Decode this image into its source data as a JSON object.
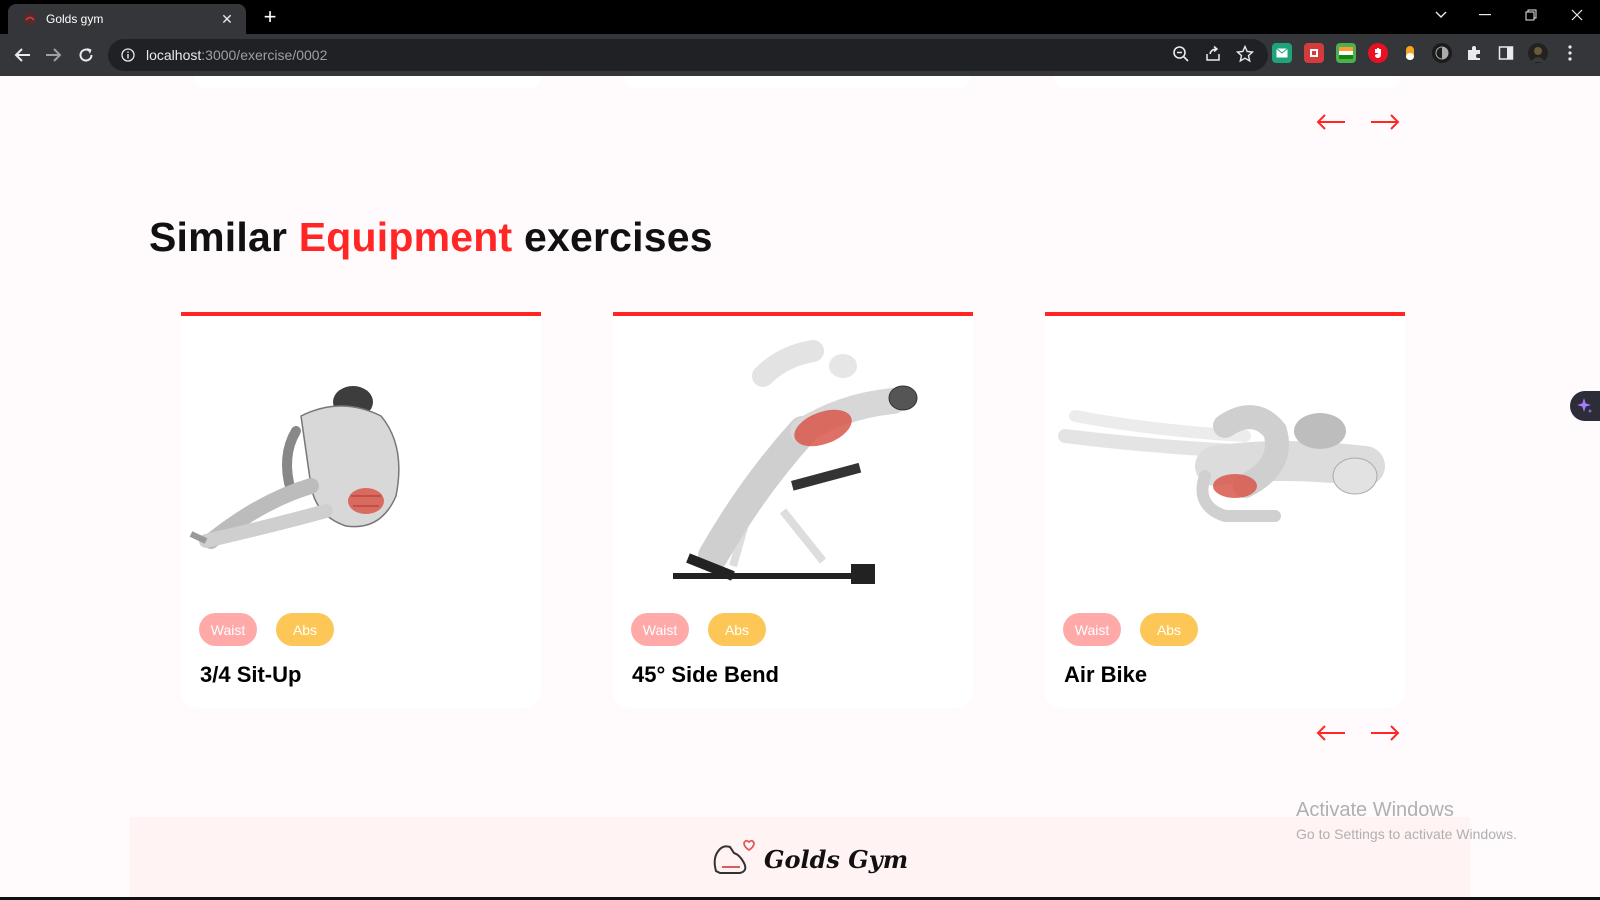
{
  "browser": {
    "tab_title": "Golds gym",
    "url_host": "localhost",
    "url_path": ":3000/exercise/0002"
  },
  "section": {
    "title_prefix": "Similar ",
    "title_accent": "Equipment",
    "title_suffix": " exercises"
  },
  "cards": [
    {
      "body_part": "Waist",
      "target": "Abs",
      "name": "3/4 Sit-Up"
    },
    {
      "body_part": "Waist",
      "target": "Abs",
      "name": "45° Side Bend"
    },
    {
      "body_part": "Waist",
      "target": "Abs",
      "name": "Air Bike"
    }
  ],
  "footer": {
    "brand": "Golds Gym"
  },
  "watermark": {
    "line1": "Activate Windows",
    "line2": "Go to Settings to activate Windows."
  },
  "colors": {
    "accent": "#ff2625",
    "body_chip": "#ffa9a9",
    "target_chip": "#fcc757",
    "page_bg": "#fffafb"
  },
  "icons": [
    "back-icon",
    "forward-icon",
    "reload-icon",
    "info-icon",
    "zoom-icon",
    "share-icon",
    "star-icon",
    "puzzle-icon",
    "sidepanel-icon",
    "more-icon",
    "arrow-left-icon",
    "arrow-right-icon"
  ]
}
